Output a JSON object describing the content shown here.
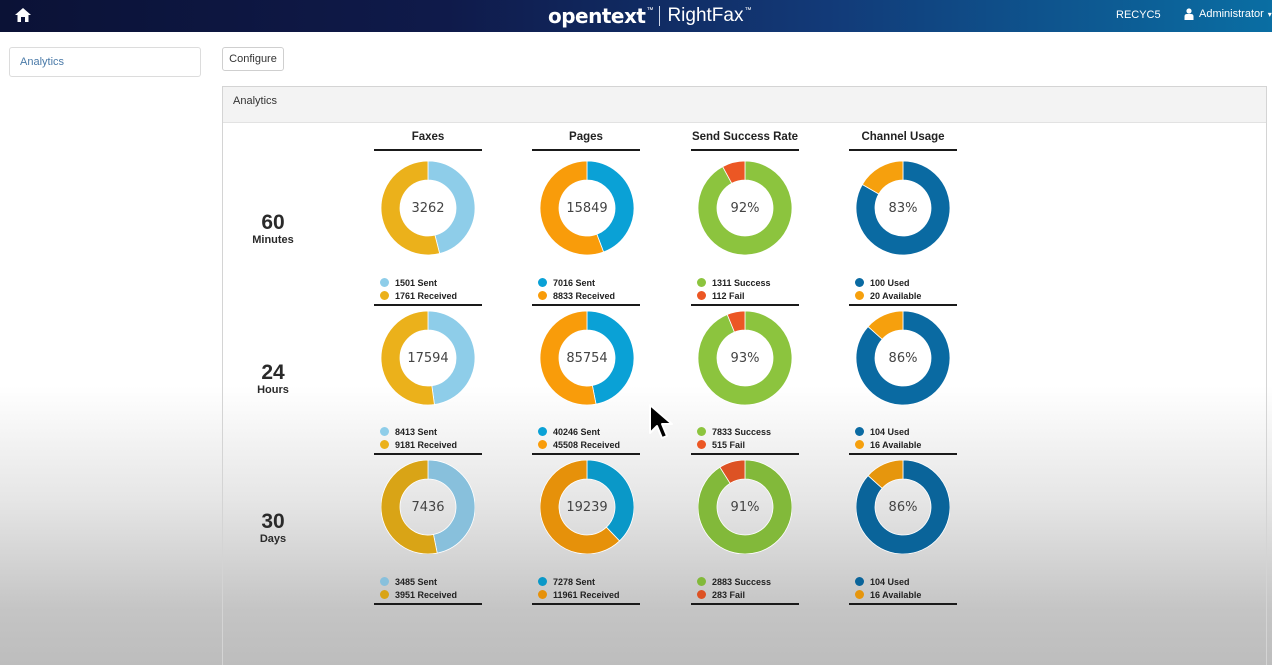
{
  "topbar": {
    "home_icon": "home-icon",
    "brand_name": "opentext",
    "brand_tm": "™",
    "product_name": "RightFax",
    "product_tm": "™",
    "server_name": "RECYC5",
    "user_icon": "user-icon",
    "user_name": "Administrator",
    "user_caret": "▾"
  },
  "sidebar": {
    "items": [
      {
        "label": "Analytics"
      }
    ]
  },
  "toolbar": {
    "configure_label": "Configure"
  },
  "panel": {
    "title": "Analytics"
  },
  "columns": [
    {
      "title": "Faxes"
    },
    {
      "title": "Pages"
    },
    {
      "title": "Send Success Rate"
    },
    {
      "title": "Channel Usage"
    }
  ],
  "rows": [
    {
      "number": "60",
      "unit": "Minutes",
      "charts": [
        {
          "center": "3262",
          "segments": [
            {
              "label": "1501 Sent",
              "value": 1501,
              "color": "#8ecde9"
            },
            {
              "label": "1761 Received",
              "value": 1761,
              "color": "#ebb11b"
            }
          ]
        },
        {
          "center": "15849",
          "segments": [
            {
              "label": "7016 Sent",
              "value": 7016,
              "color": "#0aa1d6"
            },
            {
              "label": "8833 Received",
              "value": 8833,
              "color": "#f99c0a"
            }
          ]
        },
        {
          "center": "92%",
          "segments": [
            {
              "label": "1311 Success",
              "value": 1311,
              "color": "#8cc43e"
            },
            {
              "label": "112 Fail",
              "value": 112,
              "color": "#ec5724"
            }
          ]
        },
        {
          "center": "83%",
          "segments": [
            {
              "label": "100 Used",
              "value": 100,
              "color": "#0a6aa2"
            },
            {
              "label": "20 Available",
              "value": 20,
              "color": "#f6a00d"
            }
          ]
        }
      ]
    },
    {
      "number": "24",
      "unit": "Hours",
      "charts": [
        {
          "center": "17594",
          "segments": [
            {
              "label": "8413 Sent",
              "value": 8413,
              "color": "#8ecde9"
            },
            {
              "label": "9181 Received",
              "value": 9181,
              "color": "#ebb11b"
            }
          ]
        },
        {
          "center": "85754",
          "segments": [
            {
              "label": "40246 Sent",
              "value": 40246,
              "color": "#0aa1d6"
            },
            {
              "label": "45508 Received",
              "value": 45508,
              "color": "#f99c0a"
            }
          ]
        },
        {
          "center": "93%",
          "segments": [
            {
              "label": "7833 Success",
              "value": 7833,
              "color": "#8cc43e"
            },
            {
              "label": "515 Fail",
              "value": 515,
              "color": "#ec5724"
            }
          ]
        },
        {
          "center": "86%",
          "segments": [
            {
              "label": "104 Used",
              "value": 104,
              "color": "#0a6aa2"
            },
            {
              "label": "16 Available",
              "value": 16,
              "color": "#f6a00d"
            }
          ]
        }
      ]
    },
    {
      "number": "30",
      "unit": "Days",
      "charts": [
        {
          "center": "7436",
          "segments": [
            {
              "label": "3485 Sent",
              "value": 3485,
              "color": "#88c0dc"
            },
            {
              "label": "3951 Received",
              "value": 3951,
              "color": "#d9a416"
            }
          ]
        },
        {
          "center": "19239",
          "segments": [
            {
              "label": "7278 Sent",
              "value": 7278,
              "color": "#0a98c8"
            },
            {
              "label": "11961 Received",
              "value": 11961,
              "color": "#e6910a"
            }
          ]
        },
        {
          "center": "91%",
          "segments": [
            {
              "label": "2883 Success",
              "value": 2883,
              "color": "#82b93a"
            },
            {
              "label": "283 Fail",
              "value": 283,
              "color": "#dd5224"
            }
          ]
        },
        {
          "center": "86%",
          "segments": [
            {
              "label": "104 Used",
              "value": 104,
              "color": "#0a649a"
            },
            {
              "label": "16 Available",
              "value": 16,
              "color": "#e6960d"
            }
          ]
        }
      ]
    }
  ],
  "chart_data": [
    {
      "type": "pie",
      "title": "Faxes - 60 Minutes",
      "center_label": "3262",
      "categories": [
        "Sent",
        "Received"
      ],
      "values": [
        1501,
        1761
      ]
    },
    {
      "type": "pie",
      "title": "Pages - 60 Minutes",
      "center_label": "15849",
      "categories": [
        "Sent",
        "Received"
      ],
      "values": [
        7016,
        8833
      ]
    },
    {
      "type": "pie",
      "title": "Send Success Rate - 60 Minutes",
      "center_label": "92%",
      "categories": [
        "Success",
        "Fail"
      ],
      "values": [
        1311,
        112
      ]
    },
    {
      "type": "pie",
      "title": "Channel Usage - 60 Minutes",
      "center_label": "83%",
      "categories": [
        "Used",
        "Available"
      ],
      "values": [
        100,
        20
      ]
    },
    {
      "type": "pie",
      "title": "Faxes - 24 Hours",
      "center_label": "17594",
      "categories": [
        "Sent",
        "Received"
      ],
      "values": [
        8413,
        9181
      ]
    },
    {
      "type": "pie",
      "title": "Pages - 24 Hours",
      "center_label": "85754",
      "categories": [
        "Sent",
        "Received"
      ],
      "values": [
        40246,
        45508
      ]
    },
    {
      "type": "pie",
      "title": "Send Success Rate - 24 Hours",
      "center_label": "93%",
      "categories": [
        "Success",
        "Fail"
      ],
      "values": [
        7833,
        515
      ]
    },
    {
      "type": "pie",
      "title": "Channel Usage - 24 Hours",
      "center_label": "86%",
      "categories": [
        "Used",
        "Available"
      ],
      "values": [
        104,
        16
      ]
    },
    {
      "type": "pie",
      "title": "Faxes - 30 Days",
      "center_label": "7436",
      "categories": [
        "Sent",
        "Received"
      ],
      "values": [
        3485,
        3951
      ]
    },
    {
      "type": "pie",
      "title": "Pages - 30 Days",
      "center_label": "19239",
      "categories": [
        "Sent",
        "Received"
      ],
      "values": [
        7278,
        11961
      ]
    },
    {
      "type": "pie",
      "title": "Send Success Rate - 30 Days",
      "center_label": "91%",
      "categories": [
        "Success",
        "Fail"
      ],
      "values": [
        2883,
        283
      ]
    },
    {
      "type": "pie",
      "title": "Channel Usage - 30 Days",
      "center_label": "86%",
      "categories": [
        "Used",
        "Available"
      ],
      "values": [
        104,
        16
      ]
    }
  ]
}
